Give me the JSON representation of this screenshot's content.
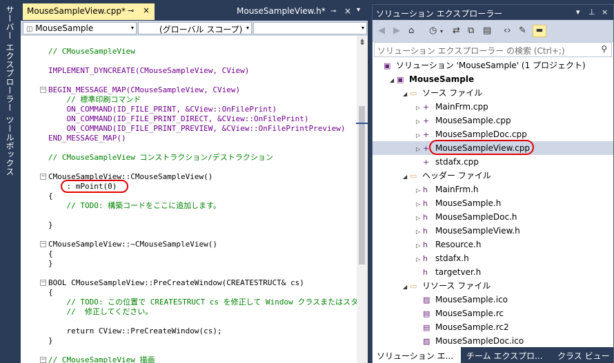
{
  "sidebar": {
    "tab1": "サーバー エクスプローラー",
    "tab2": "ツールボックス"
  },
  "editor": {
    "tabs": [
      {
        "label": "MouseSampleView.cpp*",
        "active": true
      },
      {
        "label": "MouseSampleView.h*",
        "active": false
      }
    ],
    "pin_icon": "⊸",
    "close_icon": "×",
    "dropdown_icon": "▾",
    "nav": {
      "class_selector": "MouseSample",
      "scope_selector": "(グローバル スコープ)",
      "member_selector": ""
    },
    "colors": {
      "comment": "#008000",
      "macro": "#6f008a",
      "class": "#2b91af",
      "keyword": "#0000ff",
      "highlight": "#e00000"
    }
  },
  "code": [
    {
      "t": "// CMouseSampleView",
      "c": "cm"
    },
    {
      "t": "",
      "c": ""
    },
    {
      "t": "IMPLEMENT_DYNCREATE(CMouseSampleView, CView)",
      "c": "mc"
    },
    {
      "t": "",
      "c": ""
    },
    {
      "t": "BEGIN_MESSAGE_MAP(CMouseSampleView, CView)",
      "c": "mc"
    },
    {
      "t": "    // 標準印刷コマンド",
      "c": "cm"
    },
    {
      "t": "    ON_COMMAND(ID_FILE_PRINT, &CView::OnFilePrint)",
      "c": "mc"
    },
    {
      "t": "    ON_COMMAND(ID_FILE_PRINT_DIRECT, &CView::OnFilePrint)",
      "c": "mc"
    },
    {
      "t": "    ON_COMMAND(ID_FILE_PRINT_PREVIEW, &CView::OnFilePrintPreview)",
      "c": "mc"
    },
    {
      "t": "END_MESSAGE_MAP()",
      "c": "mc"
    },
    {
      "t": "",
      "c": ""
    },
    {
      "t": "// CMouseSampleView コンストラクション/デストラクション",
      "c": "cm"
    },
    {
      "t": "",
      "c": ""
    },
    {
      "t": "CMouseSampleView::CMouseSampleView()",
      "c": ""
    },
    {
      "t": "    : mPoint(0)",
      "c": ""
    },
    {
      "t": "{",
      "c": ""
    },
    {
      "t": "    // TODO: 構築コードをここに追加します。",
      "c": "cm"
    },
    {
      "t": "",
      "c": ""
    },
    {
      "t": "}",
      "c": ""
    },
    {
      "t": "",
      "c": ""
    },
    {
      "t": "CMouseSampleView::~CMouseSampleView()",
      "c": ""
    },
    {
      "t": "{",
      "c": ""
    },
    {
      "t": "}",
      "c": ""
    },
    {
      "t": "",
      "c": ""
    },
    {
      "t": "BOOL CMouseSampleView::PreCreateWindow(CREATESTRUCT& cs)",
      "c": ""
    },
    {
      "t": "{",
      "c": ""
    },
    {
      "t": "    // TODO: この位置で CREATESTRUCT cs を修正して Window クラスまたはスタイルを",
      "c": "cm"
    },
    {
      "t": "    //  修正してください。",
      "c": "cm"
    },
    {
      "t": "",
      "c": ""
    },
    {
      "t": "    return CView::PreCreateWindow(cs);",
      "c": ""
    },
    {
      "t": "}",
      "c": ""
    },
    {
      "t": "",
      "c": ""
    },
    {
      "t": "// CMouseSampleView 描画",
      "c": "cm"
    }
  ],
  "solution": {
    "title": "ソリューション エクスプローラー",
    "search_placeholder": "ソリューション エクスプローラー の検索 (Ctrl+;)",
    "search_icon": "⚲",
    "tree": [
      {
        "label": "ソリューション 'MouseSample' (1 プロジェクト)",
        "indent": 0,
        "icon": "▣",
        "arrow": "",
        "bold": false
      },
      {
        "label": "MouseSample",
        "indent": 1,
        "icon": "▣",
        "arrow": "◢",
        "bold": true
      },
      {
        "label": "ソース ファイル",
        "indent": 2,
        "icon": "▭",
        "arrow": "◢",
        "folder": true
      },
      {
        "label": "MainFrm.cpp",
        "indent": 3,
        "icon": "+",
        "arrow": "▷"
      },
      {
        "label": "MouseSample.cpp",
        "indent": 3,
        "icon": "+",
        "arrow": "▷"
      },
      {
        "label": "MouseSampleDoc.cpp",
        "indent": 3,
        "icon": "+",
        "arrow": "▷"
      },
      {
        "label": "MouseSampleView.cpp",
        "indent": 3,
        "icon": "+",
        "arrow": "▷",
        "selected": true
      },
      {
        "label": "stdafx.cpp",
        "indent": 3,
        "icon": "+",
        "arrow": ""
      },
      {
        "label": "ヘッダー ファイル",
        "indent": 2,
        "icon": "▭",
        "arrow": "◢",
        "folder": true
      },
      {
        "label": "MainFrm.h",
        "indent": 3,
        "icon": "h",
        "arrow": "▷"
      },
      {
        "label": "MouseSample.h",
        "indent": 3,
        "icon": "h",
        "arrow": "▷"
      },
      {
        "label": "MouseSampleDoc.h",
        "indent": 3,
        "icon": "h",
        "arrow": "▷"
      },
      {
        "label": "MouseSampleView.h",
        "indent": 3,
        "icon": "h",
        "arrow": "▷"
      },
      {
        "label": "Resource.h",
        "indent": 3,
        "icon": "h",
        "arrow": "▷"
      },
      {
        "label": "stdafx.h",
        "indent": 3,
        "icon": "h",
        "arrow": "▷"
      },
      {
        "label": "targetver.h",
        "indent": 3,
        "icon": "h",
        "arrow": ""
      },
      {
        "label": "リソース ファイル",
        "indent": 2,
        "icon": "▭",
        "arrow": "◢",
        "folder": true
      },
      {
        "label": "MouseSample.ico",
        "indent": 3,
        "icon": "▨",
        "arrow": ""
      },
      {
        "label": "MouseSample.rc",
        "indent": 3,
        "icon": "▤",
        "arrow": ""
      },
      {
        "label": "MouseSample.rc2",
        "indent": 3,
        "icon": "▤",
        "arrow": ""
      },
      {
        "label": "MouseSampleDoc.ico",
        "indent": 3,
        "icon": "▨",
        "arrow": ""
      }
    ],
    "bottom_tabs": [
      "ソリューション エ...",
      "チーム エクスプロ...",
      "クラス ビュー"
    ]
  }
}
